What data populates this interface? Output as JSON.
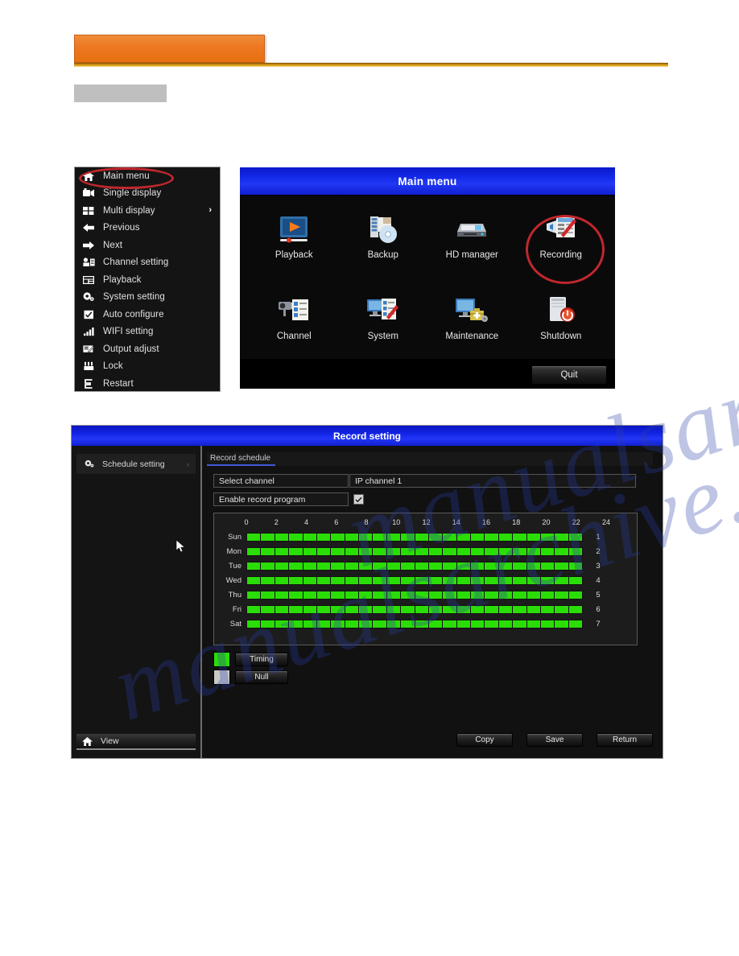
{
  "page": {
    "banner_label": "",
    "chip_label": ""
  },
  "watermark": {
    "line1": "manualsarchive.com",
    "line2": "manualsarchive.com"
  },
  "context_menu": {
    "items": [
      {
        "label": "Main menu",
        "icon": "home-icon",
        "has_submenu": false
      },
      {
        "label": "Single display",
        "icon": "single-display-icon",
        "has_submenu": false
      },
      {
        "label": "Multi display",
        "icon": "multi-display-icon",
        "has_submenu": true,
        "submenu_arrow": "›"
      },
      {
        "label": "Previous",
        "icon": "arrow-left-icon",
        "has_submenu": false
      },
      {
        "label": "Next",
        "icon": "arrow-right-icon",
        "has_submenu": false
      },
      {
        "label": "Channel setting",
        "icon": "camera-setting-icon",
        "has_submenu": false
      },
      {
        "label": "Playback",
        "icon": "playback-icon",
        "has_submenu": false
      },
      {
        "label": "System setting",
        "icon": "gear-icon",
        "has_submenu": false
      },
      {
        "label": "Auto configure",
        "icon": "checkbox-icon",
        "has_submenu": false
      },
      {
        "label": "WIFI setting",
        "icon": "wifi-icon",
        "has_submenu": false
      },
      {
        "label": "Output adjust",
        "icon": "output-adjust-icon",
        "has_submenu": false
      },
      {
        "label": "Lock",
        "icon": "lock-icon",
        "has_submenu": false
      },
      {
        "label": "Restart",
        "icon": "restart-icon",
        "has_submenu": false
      }
    ]
  },
  "main_menu_dialog": {
    "title": "Main menu",
    "items": [
      {
        "label": "Playback",
        "icon": "playback-icon"
      },
      {
        "label": "Backup",
        "icon": "backup-icon"
      },
      {
        "label": "HD manager",
        "icon": "hd-manager-icon"
      },
      {
        "label": "Recording",
        "icon": "recording-icon"
      },
      {
        "label": "Channel",
        "icon": "channel-icon"
      },
      {
        "label": "System",
        "icon": "system-icon"
      },
      {
        "label": "Maintenance",
        "icon": "maintenance-icon"
      },
      {
        "label": "Shutdown",
        "icon": "shutdown-icon"
      }
    ],
    "quit_label": "Quit"
  },
  "record_setting": {
    "title": "Record setting",
    "sidebar": {
      "item_label": "Schedule setting",
      "item_chevron": "›",
      "bottom_label": "View"
    },
    "tab_label": "Record schedule",
    "fields": {
      "select_channel_label": "Select channel",
      "select_channel_value": "IP channel 1",
      "enable_record_label": "Enable record program",
      "enable_record_checked": true
    },
    "schedule": {
      "hour_ticks": [
        "0",
        "2",
        "4",
        "6",
        "8",
        "10",
        "12",
        "14",
        "16",
        "18",
        "20",
        "22",
        "24"
      ],
      "rows": [
        {
          "day": "Sun",
          "index": "1",
          "cells": [
            "T",
            "T",
            "T",
            "T",
            "T",
            "T",
            "T",
            "T",
            "T",
            "T",
            "T",
            "T",
            "T",
            "T",
            "T",
            "T",
            "T",
            "T",
            "T",
            "T",
            "T",
            "T",
            "T",
            "T"
          ]
        },
        {
          "day": "Mon",
          "index": "2",
          "cells": [
            "T",
            "T",
            "T",
            "T",
            "T",
            "T",
            "T",
            "T",
            "T",
            "T",
            "T",
            "T",
            "T",
            "T",
            "T",
            "T",
            "T",
            "T",
            "T",
            "T",
            "T",
            "T",
            "T",
            "T"
          ]
        },
        {
          "day": "Tue",
          "index": "3",
          "cells": [
            "T",
            "T",
            "T",
            "T",
            "T",
            "T",
            "T",
            "T",
            "T",
            "T",
            "T",
            "T",
            "T",
            "T",
            "T",
            "T",
            "T",
            "T",
            "T",
            "T",
            "T",
            "T",
            "T",
            "T"
          ]
        },
        {
          "day": "Wed",
          "index": "4",
          "cells": [
            "T",
            "T",
            "T",
            "T",
            "T",
            "T",
            "T",
            "T",
            "T",
            "T",
            "T",
            "T",
            "T",
            "T",
            "T",
            "T",
            "T",
            "T",
            "T",
            "T",
            "T",
            "T",
            "T",
            "T"
          ]
        },
        {
          "day": "Thu",
          "index": "5",
          "cells": [
            "T",
            "T",
            "T",
            "T",
            "T",
            "T",
            "T",
            "T",
            "T",
            "T",
            "T",
            "T",
            "T",
            "T",
            "T",
            "T",
            "T",
            "T",
            "T",
            "T",
            "T",
            "T",
            "T",
            "T"
          ]
        },
        {
          "day": "Fri",
          "index": "6",
          "cells": [
            "T",
            "T",
            "T",
            "T",
            "T",
            "T",
            "T",
            "T",
            "T",
            "T",
            "T",
            "T",
            "T",
            "T",
            "T",
            "T",
            "T",
            "T",
            "T",
            "T",
            "T",
            "T",
            "T",
            "T"
          ]
        },
        {
          "day": "Sat",
          "index": "7",
          "cells": [
            "T",
            "T",
            "T",
            "T",
            "T",
            "T",
            "T",
            "T",
            "T",
            "T",
            "T",
            "T",
            "T",
            "T",
            "T",
            "T",
            "T",
            "T",
            "T",
            "T",
            "T",
            "T",
            "T",
            "T"
          ]
        }
      ]
    },
    "legend": [
      {
        "label": "Timing",
        "color": "#2bdd07"
      },
      {
        "label": "Null",
        "color": "#c9c9c9"
      }
    ],
    "buttons": [
      {
        "label": "Copy"
      },
      {
        "label": "Save"
      },
      {
        "label": "Return"
      }
    ]
  },
  "colors": {
    "timing_green": "#2bdd07",
    "null_gray": "#c9c9c9",
    "titlebar_blue": "#1325e6",
    "annotation_red": "#c0272d",
    "banner_orange": "#ed7822"
  }
}
